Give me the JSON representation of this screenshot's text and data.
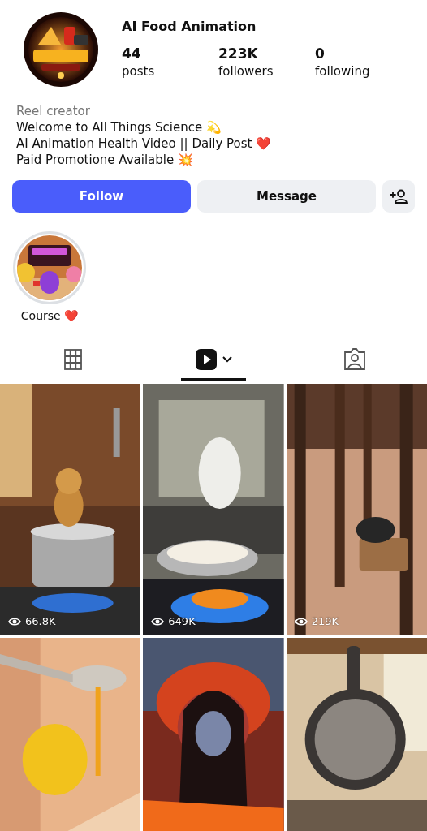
{
  "profile": {
    "name": "AI Food Animation",
    "stats": [
      {
        "value": "44",
        "label": "posts"
      },
      {
        "value": "223K",
        "label": "followers"
      },
      {
        "value": "0",
        "label": "following"
      }
    ]
  },
  "bio": {
    "category": "Reel creator",
    "lines": [
      "Welcome to All Things Science 💫",
      "AI Animation Health Video || Daily Post ❤️",
      "Paid Promotione Available 💥"
    ]
  },
  "buttons": [
    {
      "kind": "primary",
      "label": "Follow"
    },
    {
      "kind": "secondary",
      "label": "Message"
    },
    {
      "kind": "add-person"
    }
  ],
  "highlights": [
    {
      "label": "Course ❤️"
    }
  ],
  "tabs": [
    {
      "kind": "grid",
      "selected": false
    },
    {
      "kind": "reels",
      "selected": true
    },
    {
      "kind": "tagged",
      "selected": false
    }
  ],
  "posts": [
    {
      "kind": "picture",
      "views": "66.8K"
    },
    {
      "kind": "picture",
      "views": "649K"
    },
    {
      "kind": "picture",
      "views": "219K"
    },
    {
      "kind": "picture"
    },
    {
      "kind": "picture"
    },
    {
      "kind": "picture"
    }
  ]
}
